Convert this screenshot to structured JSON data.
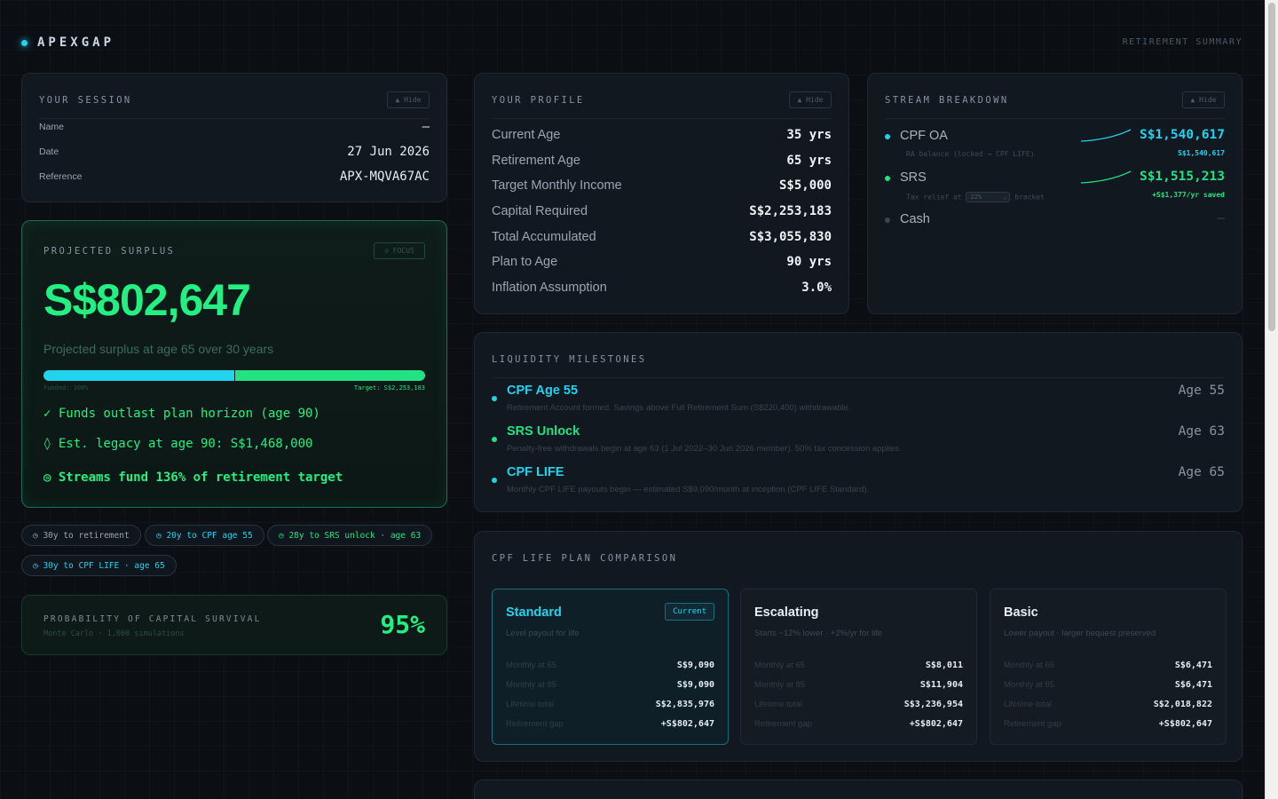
{
  "header": {
    "brand": "APEXGAP",
    "right_label": "RETIREMENT SUMMARY"
  },
  "session": {
    "title": "YOUR SESSION",
    "hide_label": "▲ Hide",
    "rows": [
      {
        "label": "Name",
        "value": "—"
      },
      {
        "label": "Date",
        "value": "27 Jun 2026"
      },
      {
        "label": "Reference",
        "value": "APX-MQVA67AC"
      }
    ]
  },
  "surplus": {
    "title": "PROJECTED SURPLUS",
    "focus_label": "⊙ FOCUS",
    "amount": "S$802,647",
    "subtitle": "Projected surplus at age 65 over 30 years",
    "funded_label": "Funded: 100%",
    "funded_fraction": 0.5,
    "target_label": "Target: S$2,253,183",
    "lines": [
      "✓ Funds outlast plan horizon (age 90)",
      "◊ Est. legacy at age 90: S$1,468,000",
      "◎ Streams fund 136% of retirement target"
    ]
  },
  "chips": [
    {
      "text": "◷ 30y to retirement",
      "color": "#9aa5b1"
    },
    {
      "text": "◷ 20y to CPF age 55",
      "color": "#22d3ee"
    },
    {
      "text": "◷ 28y to SRS unlock · age 63",
      "color": "#22e283"
    },
    {
      "text": "◷ 30y to CPF LIFE · age 65",
      "color": "#22d3ee"
    }
  ],
  "probability": {
    "title": "PROBABILITY OF CAPITAL SURVIVAL",
    "subtitle": "Monte Carlo · 1,000 simulations",
    "value": "95%"
  },
  "profile": {
    "title": "YOUR PROFILE",
    "hide_label": "▲ Hide",
    "rows": [
      {
        "label": "Current Age",
        "value": "35 yrs"
      },
      {
        "label": "Retirement Age",
        "value": "65 yrs"
      },
      {
        "label": "Target Monthly Income",
        "value": "S$5,000"
      },
      {
        "label": "Capital Required",
        "value": "S$2,253,183"
      },
      {
        "label": "Total Accumulated",
        "value": "S$3,055,830"
      },
      {
        "label": "Plan to Age",
        "value": "90 yrs"
      },
      {
        "label": "Inflation Assumption",
        "value": "3.0%"
      }
    ]
  },
  "streams": {
    "title": "STREAM BREAKDOWN",
    "hide_label": "▲ Hide",
    "items": [
      {
        "name": "CPF OA",
        "value": "S$1,540,617",
        "sub": "RA balance (locked → CPF LIFE)",
        "sub_right": "S$1,540,617",
        "color": "#22d3ee"
      },
      {
        "name": "SRS",
        "value": "S$1,515,213",
        "sub_prefix": "Tax relief at",
        "select_value": "22%",
        "sub_suffix": "bracket",
        "sub_right": "+S$1,377/yr saved",
        "color": "#22e283"
      },
      {
        "name": "Cash",
        "value": "—",
        "color": "#3a4552"
      }
    ]
  },
  "milestones": {
    "title": "LIQUIDITY MILESTONES",
    "items": [
      {
        "name": "CPF Age 55",
        "desc": "Retirement Account formed. Savings above Full Retirement Sum (S$220,400) withdrawable.",
        "age": "Age 55",
        "color": "#22d3ee"
      },
      {
        "name": "SRS Unlock",
        "desc": "Penalty-free withdrawals begin at age 63 (1 Jul 2022–30 Jun 2026 member). 50% tax concession applies.",
        "age": "Age 63",
        "color": "#22e283"
      },
      {
        "name": "CPF LIFE",
        "desc": "Monthly CPF LIFE payouts begin — estimated S$9,090/month at inception (CPF LIFE Standard).",
        "age": "Age 65",
        "color": "#22d3ee"
      }
    ]
  },
  "plans": {
    "title": "CPF LIFE PLAN COMPARISON",
    "items": [
      {
        "name": "Standard",
        "badge": "Current",
        "desc": "Level payout for life",
        "rows": [
          {
            "label": "Monthly at 65",
            "value": "S$9,090"
          },
          {
            "label": "Monthly at 85",
            "value": "S$9,090"
          },
          {
            "label": "Lifetime total",
            "value": "S$2,835,976"
          },
          {
            "label": "Retirement gap",
            "value": "+S$802,647"
          }
        ]
      },
      {
        "name": "Escalating",
        "desc": "Starts ~12% lower · +2%/yr for life",
        "rows": [
          {
            "label": "Monthly at 65",
            "value": "S$8,011"
          },
          {
            "label": "Monthly at 85",
            "value": "S$11,904"
          },
          {
            "label": "Lifetime total",
            "value": "S$3,236,954"
          },
          {
            "label": "Retirement gap",
            "value": "+S$802,647"
          }
        ]
      },
      {
        "name": "Basic",
        "desc": "Lower payout · larger bequest preserved",
        "rows": [
          {
            "label": "Monthly at 65",
            "value": "S$6,471"
          },
          {
            "label": "Monthly at 85",
            "value": "S$6,471"
          },
          {
            "label": "Lifetime total",
            "value": "S$2,018,822"
          },
          {
            "label": "Retirement gap",
            "value": "+S$802,647"
          }
        ]
      }
    ]
  }
}
